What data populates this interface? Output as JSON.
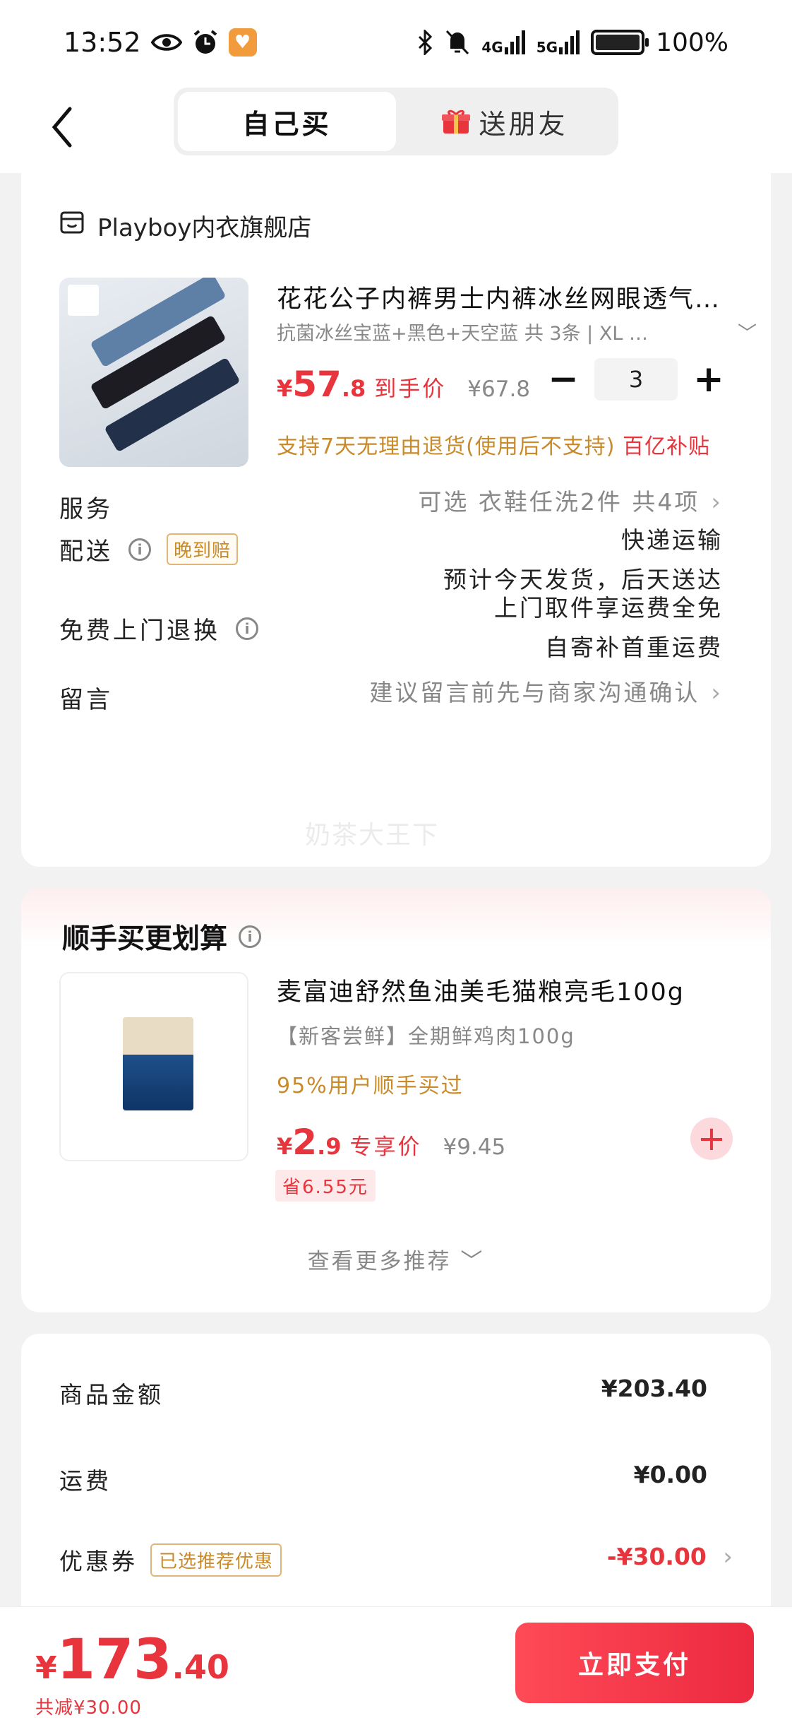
{
  "status_bar": {
    "time": "13:52",
    "network_1": "4G",
    "network_2": "5G",
    "battery": "100%"
  },
  "header": {
    "tabs": [
      {
        "label": "自己买",
        "active": true
      },
      {
        "label": "送朋友",
        "active": false
      }
    ]
  },
  "store": {
    "name": "Playboy内衣旗舰店",
    "product": {
      "title": "花花公子内裤男士内裤冰丝网眼透气…",
      "sku": "抗菌冰丝宝蓝+黑色+天空蓝  共 3条 | XL  …",
      "price_currency": "¥",
      "price_int": "57",
      "price_dec": ".8",
      "price_tag": "到手价",
      "original_price": "¥67.8",
      "quantity": "3",
      "return_note": "支持7天无理由退货(使用后不支持)",
      "subsidy": "百亿补贴"
    },
    "rows": {
      "service_label": "服务",
      "service_value": "可选  衣鞋任洗2件 共4项",
      "delivery_label": "配送",
      "delivery_badge": "晚到赔",
      "delivery_value_1": "快递运输",
      "delivery_value_2": "预计今天发货，后天送达",
      "return_label": "免费上门退换",
      "return_value_1": "上门取件享运费全免",
      "return_value_2": "自寄补首重运费",
      "message_label": "留言",
      "message_placeholder": "建议留言前先与商家沟通确认"
    },
    "watermark": "奶茶大王下"
  },
  "addon": {
    "title": "顺手买更划算",
    "name": "麦富迪舒然鱼油美毛猫粮亮毛100g",
    "sub": "【新客尝鲜】全期鲜鸡肉100g",
    "social": "95%用户顺手买过",
    "price_currency": "¥",
    "price_int": "2",
    "price_dec": ".9",
    "price_tag": "专享价",
    "original_price": "¥9.45",
    "save": "省6.55元",
    "more": "查看更多推荐"
  },
  "summary": {
    "goods_label": "商品金额",
    "goods_value": "¥203.40",
    "shipping_label": "运费",
    "shipping_value": "¥0.00",
    "coupon_label": "优惠券",
    "coupon_badge": "已选推荐优惠",
    "coupon_value": "-¥30.00"
  },
  "bottom": {
    "currency": "¥",
    "total_int": "173",
    "total_dec": ".40",
    "saving": "共减¥30.00",
    "pay_label": "立即支付"
  },
  "colors": {
    "accent": "#e8343c",
    "gold": "#c98a2a"
  }
}
